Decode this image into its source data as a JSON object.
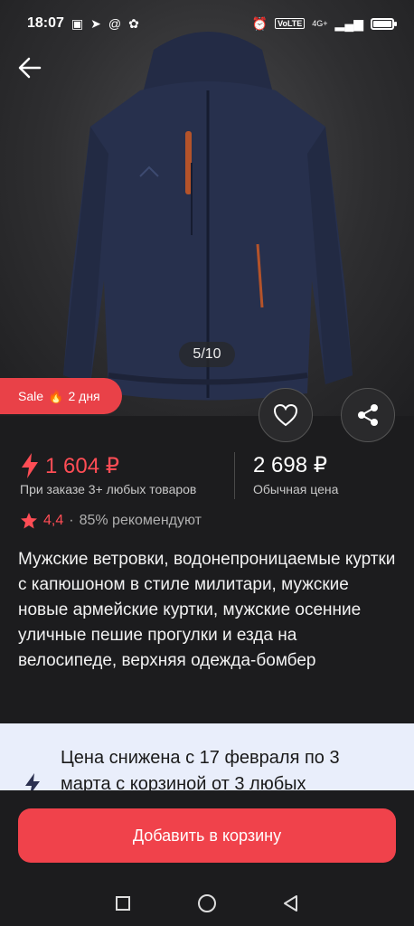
{
  "status_bar": {
    "time": "18:07",
    "left_icons": [
      "box-icon",
      "telegram-icon",
      "at-icon",
      "app-icon"
    ],
    "right_icons": [
      "alarm-icon",
      "volte-icon",
      "signal-icon",
      "battery-icon"
    ],
    "volte_label": "VoLTE",
    "network_label": "4G+",
    "battery_level": 1.0
  },
  "gallery": {
    "counter": "5/10",
    "image_alt": "Мужская ветровка с капюшоном",
    "jacket_color": "#27304d"
  },
  "sale_badge": {
    "label": "Sale",
    "duration": "2 дня"
  },
  "pricing": {
    "promo_price": "1 604 ₽",
    "promo_note": "При заказе 3+ любых товаров",
    "regular_price": "2 698 ₽",
    "regular_note": "Обычная цена"
  },
  "rating": {
    "value": "4,4",
    "separator": "·",
    "recommend": "85% рекомендуют"
  },
  "product_title": "Мужские ветровки, водонепроницаемые куртки с капюшоном в стиле милитари, мужские новые армейские куртки, мужские осенние уличные пешие прогулки и езда на велосипеде, верхняя одежда-бомбер",
  "promo_card": {
    "text": "Цена снижена с 17 февраля по 3 марта с корзиной от 3 любых"
  },
  "cart_button": {
    "label": "Добавить в корзину"
  },
  "colors": {
    "accent": "#f0424b",
    "background": "#1c1c1e",
    "promo_card_bg": "#e9eefb"
  }
}
